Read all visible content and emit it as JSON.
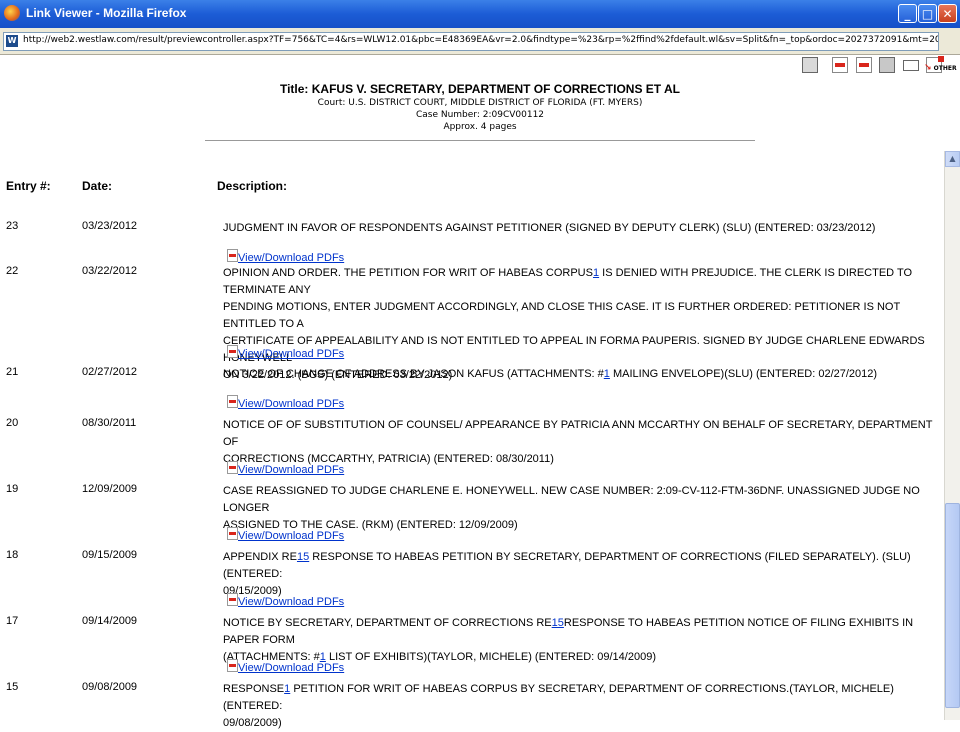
{
  "window": {
    "title": "Link Viewer - Mozilla Firefox",
    "minimize_label": "_",
    "maximize_label": "□",
    "close_label": "✕"
  },
  "urlbar": {
    "site_badge": "W",
    "url": "http://web2.westlaw.com/result/previewcontroller.aspx?TF=756&TC=4&rs=WLW12.01&pbc=E48369EA&vr=2.0&findtype=%23&rp=%2ffind%2fdefault.wl&sv=Split&fn=_top&ordoc=2027372091&mt=205&docname=LINK-GUID(IBF0B6F29037811DEE"
  },
  "toolbar": {
    "icons": [
      "print-icon",
      "pdf-icon",
      "pdf-icon",
      "save-icon",
      "email-icon",
      "document-icon"
    ],
    "other_label": "OTHER",
    "other_arrow": "↘"
  },
  "header": {
    "title": "Title: KAFUS V. SECRETARY, DEPARTMENT OF CORRECTIONS ET AL",
    "court": "Court: U.S. DISTRICT COURT, MIDDLE DISTRICT OF FLORIDA (FT. MYERS)",
    "case_number": "Case Number: 2:09CV00112",
    "pages": "Approx. 4 pages"
  },
  "columns": {
    "entry": "Entry #:",
    "date": "Date:",
    "description": "Description:"
  },
  "pdf_link_label": "View/Download PDFs",
  "entries": [
    {
      "num": "23",
      "date": "03/23/2012",
      "lines": [
        [
          "JUDGMENT IN FAVOR OF RESPONDENTS AGAINST PETITIONER (SIGNED BY DEPUTY CLERK) (SLU) (ENTERED: 03/23/2012)"
        ]
      ]
    },
    {
      "num": "22",
      "date": "03/22/2012",
      "lines": [
        [
          "OPINION AND ORDER. THE PETITION FOR WRIT OF HABEAS CORPUS",
          "1",
          " IS DENIED WITH PREJUDICE. THE CLERK IS DIRECTED TO TERMINATE ANY"
        ],
        [
          "PENDING MOTIONS, ENTER JUDGMENT ACCORDINGLY, AND CLOSE THIS CASE. IT IS FURTHER ORDERED: PETITIONER IS NOT ENTITLED TO A"
        ],
        [
          "CERTIFICATE OF APPEALABILITY AND IS NOT ENTITLED TO APPEAL IN FORMA PAUPERIS. SIGNED BY JUDGE CHARLENE EDWARDS HONEYWELL"
        ],
        [
          "ON 3/22/2012. (BGS) (ENTERED: 03/22/2012)"
        ]
      ]
    },
    {
      "num": "21",
      "date": "02/27/2012",
      "lines": [
        [
          "NOTICE OF CHANGE OF ADDRESS BY JASON KAFUS (ATTACHMENTS: #",
          "1",
          " MAILING ENVELOPE)(SLU) (ENTERED: 02/27/2012)"
        ]
      ]
    },
    {
      "num": "20",
      "date": "08/30/2011",
      "lines": [
        [
          "NOTICE OF OF SUBSTITUTION OF COUNSEL/ APPEARANCE BY PATRICIA ANN MCCARTHY ON BEHALF OF SECRETARY, DEPARTMENT OF"
        ],
        [
          "CORRECTIONS (MCCARTHY, PATRICIA) (ENTERED: 08/30/2011)"
        ]
      ]
    },
    {
      "num": "19",
      "date": "12/09/2009",
      "lines": [
        [
          "CASE REASSIGNED TO JUDGE CHARLENE E. HONEYWELL. NEW CASE NUMBER: 2:09-CV-112-FTM-36DNF. UNASSIGNED JUDGE NO LONGER"
        ],
        [
          "ASSIGNED TO THE CASE. (RKM) (ENTERED: 12/09/2009)"
        ]
      ]
    },
    {
      "num": "18",
      "date": "09/15/2009",
      "lines": [
        [
          "APPENDIX RE",
          "15",
          " RESPONSE TO HABEAS PETITION BY SECRETARY, DEPARTMENT OF CORRECTIONS (FILED SEPARATELY). (SLU) (ENTERED:"
        ],
        [
          "09/15/2009)"
        ]
      ]
    },
    {
      "num": "17",
      "date": "09/14/2009",
      "lines": [
        [
          "NOTICE BY SECRETARY, DEPARTMENT OF CORRECTIONS RE",
          "15",
          "RESPONSE TO HABEAS PETITION NOTICE OF FILING EXHIBITS IN PAPER FORM"
        ],
        [
          "(ATTACHMENTS: #",
          "1",
          " LIST OF EXHIBITS)(TAYLOR, MICHELE) (ENTERED: 09/14/2009)"
        ]
      ]
    },
    {
      "num": "15",
      "date": "09/08/2009",
      "lines": [
        [
          "RESPONSE",
          "1",
          " PETITION FOR WRIT OF HABEAS CORPUS BY SECRETARY, DEPARTMENT OF CORRECTIONS.(TAYLOR, MICHELE) (ENTERED:"
        ],
        [
          "09/08/2009)"
        ]
      ]
    }
  ]
}
